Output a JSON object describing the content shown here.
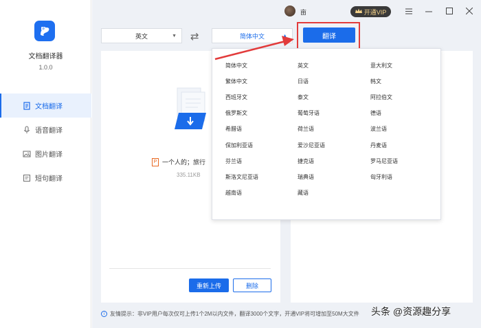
{
  "app": {
    "name": "文档翻译器",
    "version": "1.0.0"
  },
  "sidebar": {
    "items": [
      {
        "label": "文档翻译",
        "active": true,
        "icon": "document-icon"
      },
      {
        "label": "语音翻译",
        "active": false,
        "icon": "microphone-icon"
      },
      {
        "label": "图片翻译",
        "active": false,
        "icon": "image-icon"
      },
      {
        "label": "短句翻译",
        "active": false,
        "icon": "text-icon"
      }
    ]
  },
  "titlebar": {
    "username": "亩",
    "vip_label": "开通VIP",
    "menu_icon": "menu-icon",
    "minimize_icon": "minimize-icon",
    "maximize_icon": "maximize-icon",
    "close_icon": "close-icon"
  },
  "toolbar": {
    "source_lang": "英文",
    "target_lang": "简体中文",
    "translate_label": "翻译",
    "swap_icon": "swap-icon"
  },
  "file": {
    "name": "一个人的；旅行",
    "size": "335.11KB",
    "type_badge": "P"
  },
  "actions": {
    "reupload_label": "重新上传",
    "delete_label": "删除"
  },
  "tip": {
    "text": "友情提示：非VIP用户每次仅可上传1个2M以内文件，翻译3000个文字，开通VIP将可增加至50M大文件"
  },
  "watermark": "头条 @资源趣分享",
  "languages": [
    "简体中文",
    "英文",
    "意大利文",
    "繁体中文",
    "日语",
    "韩文",
    "西班牙文",
    "泰文",
    "阿拉伯文",
    "俄罗斯文",
    "葡萄牙语",
    "德语",
    "希腊语",
    "荷兰语",
    "波兰语",
    "保加利亚语",
    "爱沙尼亚语",
    "丹麦语",
    "芬兰语",
    "捷克语",
    "罗马尼亚语",
    "斯洛文尼亚语",
    "瑞典语",
    "匈牙利语",
    "越南语",
    "藏语"
  ],
  "colors": {
    "accent": "#1b6cea",
    "highlight": "#e23b3b",
    "vip_gold": "#f7d48b"
  }
}
